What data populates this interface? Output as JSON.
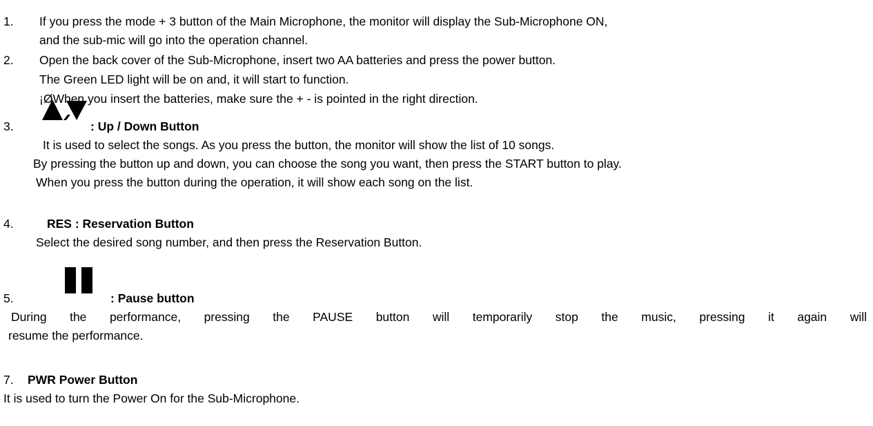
{
  "items": [
    {
      "number": "1.",
      "lines": [
        "If you press the mode + 3 button of the Main Microphone, the monitor will display the Sub-Microphone ON,",
        "and the sub-mic will go into the operation channel."
      ]
    },
    {
      "number": "2.",
      "lines": [
        "Open the back cover of the Sub-Microphone, insert two AA batteries and press the power button.",
        "The Green LED light will be on and, it will start to function.",
        "¡ØWhen you insert the batteries, make sure the + - is pointed in the right direction."
      ]
    },
    {
      "number": "3.",
      "icon": "up-down-arrows-icon",
      "heading": ": Up / Down Button",
      "lines": [
        "It is used to select the songs. As you press the button, the monitor will show the list of 10 songs.",
        "By pressing the button up and down, you can choose the song you want, then press the START button to play.",
        "When you press the button during the operation, it will show each song on the list."
      ]
    },
    {
      "number": "4.",
      "heading": "RES : Reservation Button",
      "lines": [
        "Select the desired song number, and then press the Reservation Button."
      ]
    },
    {
      "number": "5.",
      "icon": "pause-icon",
      "heading": ": Pause button",
      "lines": [
        "During the performance, pressing the PAUSE button will temporarily stop the music, pressing it again will",
        "resume the performance."
      ]
    },
    {
      "number": "7.",
      "heading": "PWR Power Button",
      "lines": [
        "It is used to turn the Power On for the Sub-Microphone."
      ]
    }
  ]
}
